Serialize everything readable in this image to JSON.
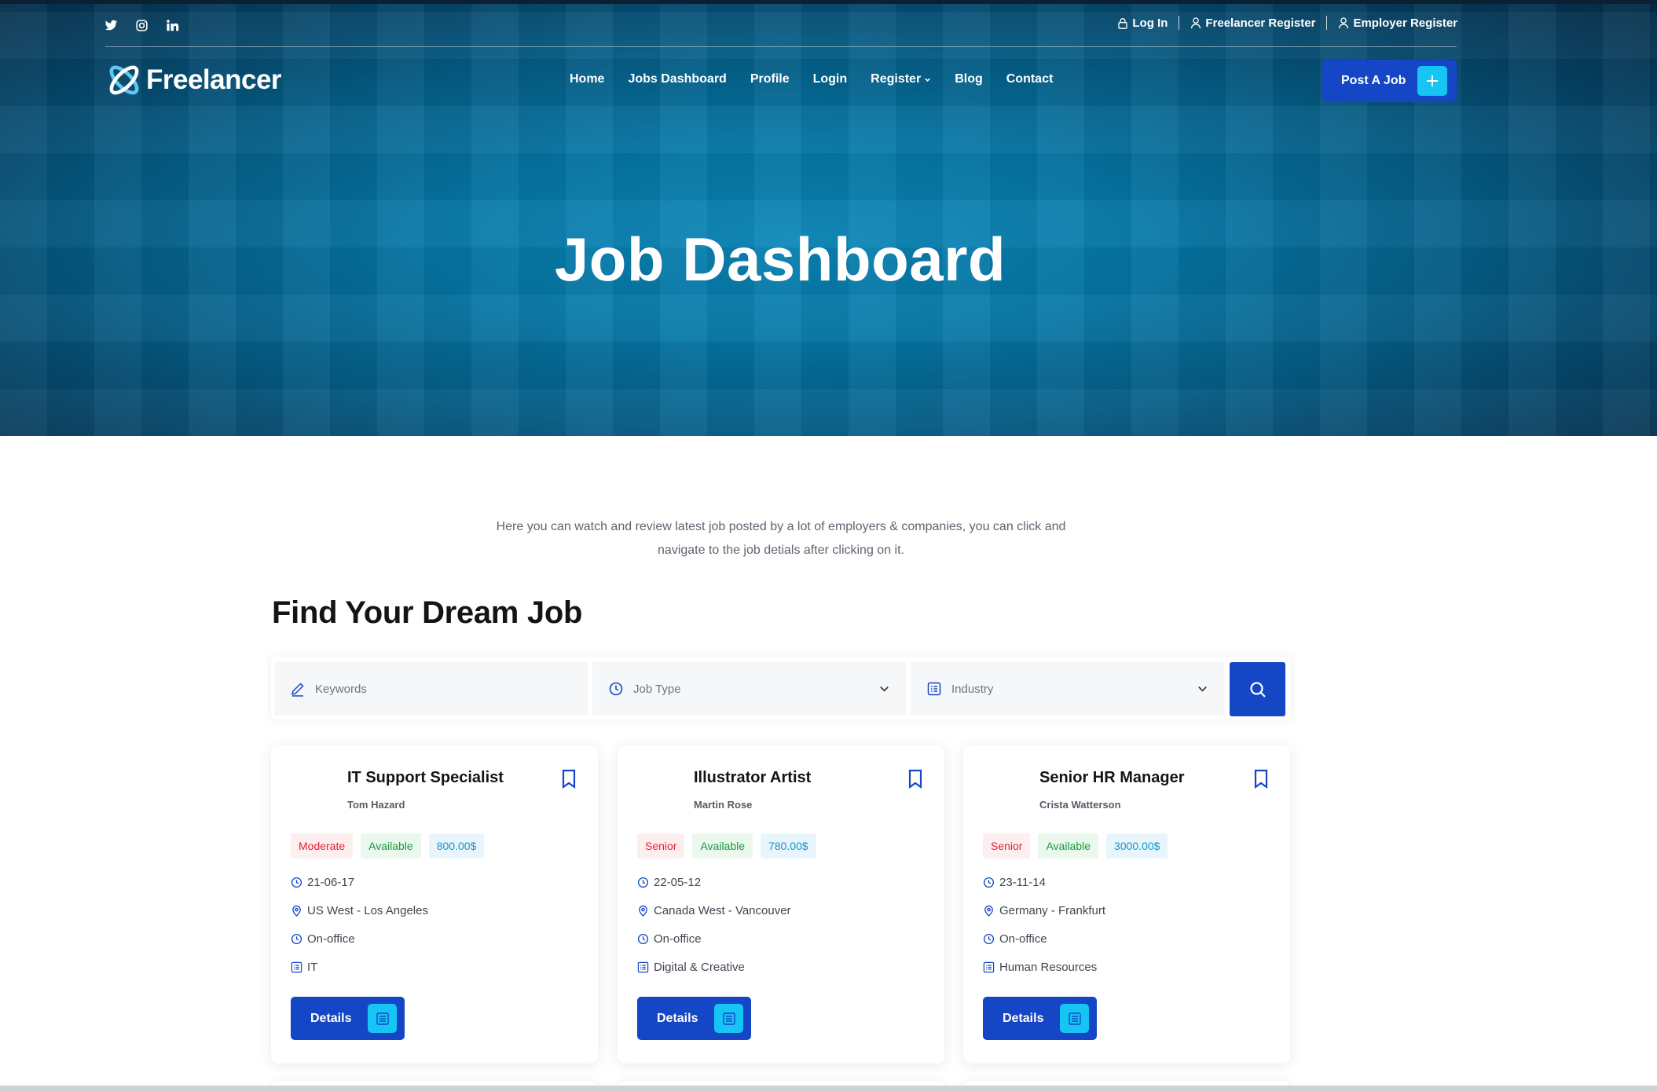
{
  "header": {
    "social": [
      {
        "name": "twitter-icon"
      },
      {
        "name": "instagram-icon"
      },
      {
        "name": "linkedin-icon"
      }
    ],
    "top_links": {
      "login": "Log In",
      "freelancer_register": "Freelancer Register",
      "employer_register": "Employer Register"
    },
    "logo_text": "Freelancer",
    "nav": [
      {
        "label": "Home"
      },
      {
        "label": "Jobs Dashboard"
      },
      {
        "label": "Profile"
      },
      {
        "label": "Login"
      },
      {
        "label": "Register"
      },
      {
        "label": "Blog"
      },
      {
        "label": "Contact"
      }
    ],
    "post_job_label": "Post A Job"
  },
  "hero": {
    "title": "Job Dashboard"
  },
  "intro": {
    "line1": "Here you can watch and review latest job posted by a lot of employers & companies, you can click and",
    "line2": "navigate to the job detials after clicking on it."
  },
  "search": {
    "title": "Find Your Dream Job",
    "keywords_placeholder": "Keywords",
    "job_type_placeholder": "Job Type",
    "industry_placeholder": "Industry"
  },
  "jobs": [
    {
      "title": "IT Support Specialist",
      "company": "Tom Hazard",
      "level": "Moderate",
      "status": "Available",
      "price": "800.00$",
      "date": "21-06-17",
      "location": "US West - Los Angeles",
      "mode": "On-office",
      "industry": "IT",
      "button": "Details"
    },
    {
      "title": "Illustrator Artist",
      "company": "Martin Rose",
      "level": "Senior",
      "status": "Available",
      "price": "780.00$",
      "date": "22-05-12",
      "location": "Canada West - Vancouver",
      "mode": "On-office",
      "industry": "Digital & Creative",
      "button": "Details"
    },
    {
      "title": "Senior HR Manager",
      "company": "Crista Watterson",
      "level": "Senior",
      "status": "Available",
      "price": "3000.00$",
      "date": "23-11-14",
      "location": "Germany - Frankfurt",
      "mode": "On-office",
      "industry": "Human Resources",
      "button": "Details"
    }
  ],
  "colors": {
    "primary": "#1546c6",
    "accent": "#17c5f5",
    "hero": "#0577a6",
    "level": "#e3202f",
    "available": "#1a9a3b",
    "price": "#1393d0"
  }
}
